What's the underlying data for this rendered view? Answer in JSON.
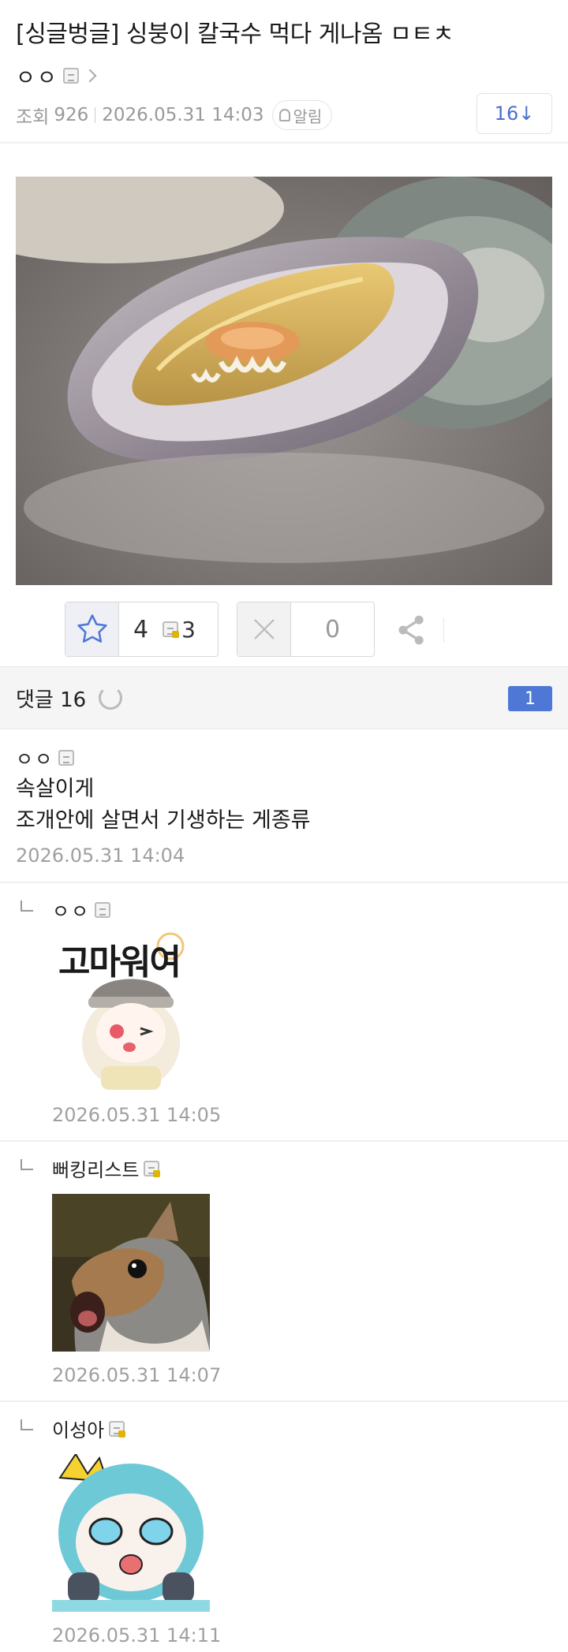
{
  "post": {
    "title": "[싱글벙글] 싱붕이 칼국수 먹다 게나옴 ㅁㅌㅊ",
    "author": "ㅇㅇ",
    "views_label": "조회",
    "views": "926",
    "datetime": "2026.05.31 14:03",
    "alarm_label": "알림",
    "comment_jump": "16↓"
  },
  "votes": {
    "up": "4",
    "fixed_up": "3",
    "down": "0"
  },
  "comments_bar": {
    "label": "댓글 16",
    "page": "1"
  },
  "comments": [
    {
      "author": "ㅇㅇ",
      "line1": "속살이게",
      "line2": "조개안에 살면서 기생하는 게종류",
      "date": "2026.05.31 14:04"
    },
    {
      "author": "ㅇㅇ",
      "sticker_text": "고마워여",
      "date": "2026.05.31 14:05"
    },
    {
      "author": "뻐킹리스트",
      "date": "2026.05.31 14:07"
    },
    {
      "author": "이성아",
      "date": "2026.05.31 14:11"
    }
  ],
  "colors": {
    "accent": "#4f78d6",
    "link_count": "#4b6fd0",
    "muted": "#999999"
  }
}
